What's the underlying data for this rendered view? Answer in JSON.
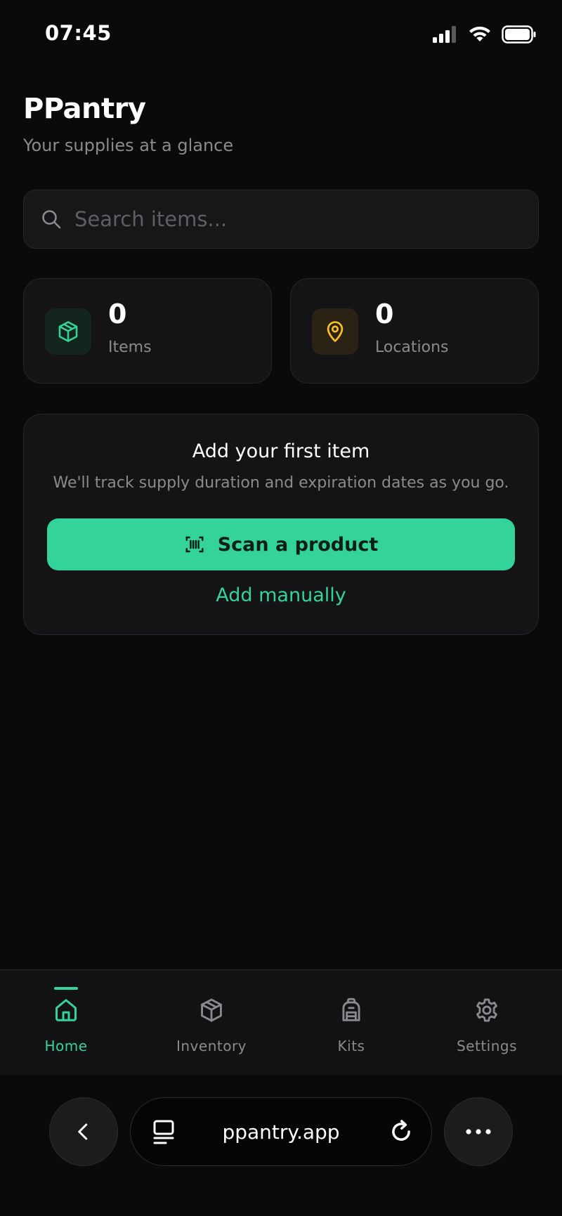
{
  "status_bar": {
    "time": "07:45"
  },
  "header": {
    "title": "PPantry",
    "subtitle": "Your supplies at a glance"
  },
  "search": {
    "placeholder": "Search items..."
  },
  "stats": [
    {
      "value": "0",
      "label": "Items",
      "icon": "box-icon",
      "color": "#34d399"
    },
    {
      "value": "0",
      "label": "Locations",
      "icon": "map-pin-icon",
      "color": "#fbbf24"
    }
  ],
  "empty_state": {
    "title": "Add your first item",
    "description": "We'll track supply duration and expiration dates as you go.",
    "scan_label": "Scan a product",
    "manual_label": "Add manually"
  },
  "nav": {
    "items": [
      {
        "label": "Home",
        "icon": "home-icon",
        "active": true
      },
      {
        "label": "Inventory",
        "icon": "box-icon",
        "active": false
      },
      {
        "label": "Kits",
        "icon": "backpack-icon",
        "active": false
      },
      {
        "label": "Settings",
        "icon": "gear-icon",
        "active": false
      }
    ]
  },
  "browser": {
    "url": "ppantry.app"
  },
  "colors": {
    "accent": "#34d399",
    "location_accent": "#fbbf24",
    "background": "#0a0a0b",
    "card": "#141416"
  }
}
